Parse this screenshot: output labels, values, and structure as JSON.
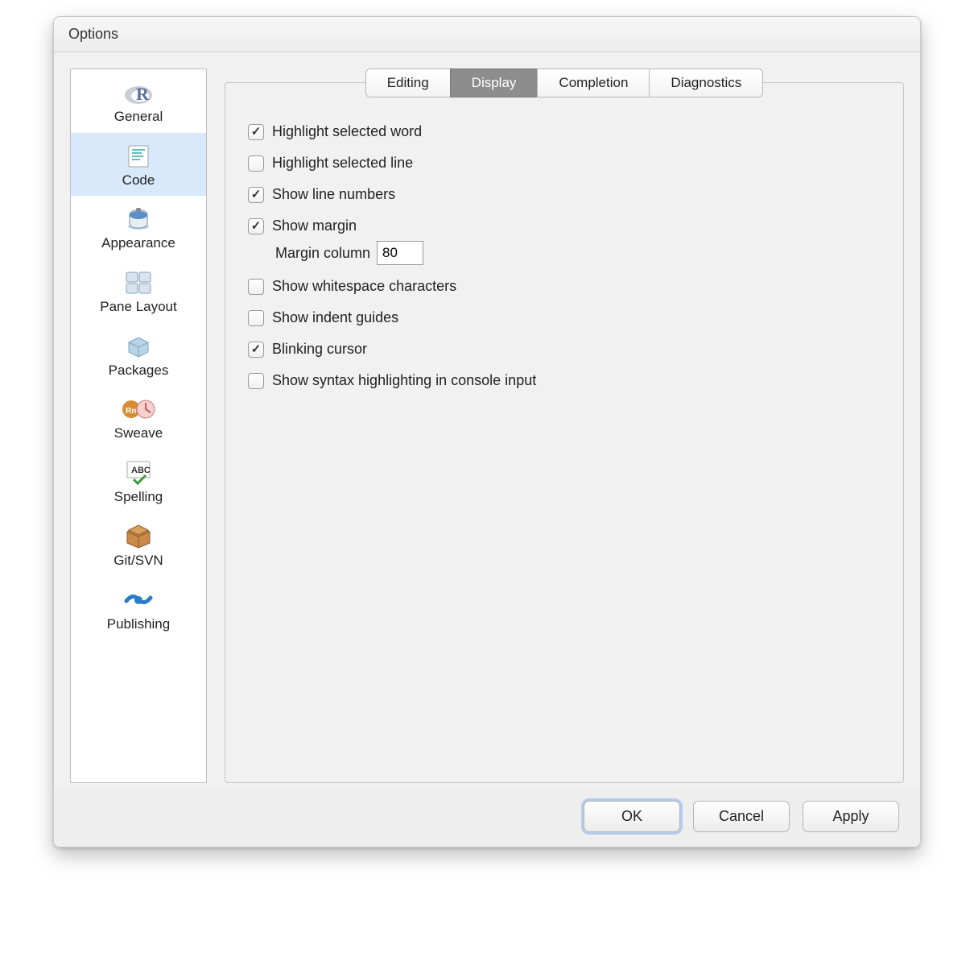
{
  "window_title": "Options",
  "sidebar": {
    "items": [
      {
        "id": "general",
        "label": "General"
      },
      {
        "id": "code",
        "label": "Code",
        "selected": true
      },
      {
        "id": "appearance",
        "label": "Appearance"
      },
      {
        "id": "pane-layout",
        "label": "Pane Layout"
      },
      {
        "id": "packages",
        "label": "Packages"
      },
      {
        "id": "sweave",
        "label": "Sweave"
      },
      {
        "id": "spelling",
        "label": "Spelling"
      },
      {
        "id": "gitsvn",
        "label": "Git/SVN"
      },
      {
        "id": "publishing",
        "label": "Publishing"
      }
    ]
  },
  "tabs": [
    {
      "id": "editing",
      "label": "Editing"
    },
    {
      "id": "display",
      "label": "Display",
      "active": true
    },
    {
      "id": "completion",
      "label": "Completion"
    },
    {
      "id": "diagnostics",
      "label": "Diagnostics"
    }
  ],
  "options": {
    "highlight_word": {
      "label": "Highlight selected word",
      "checked": true
    },
    "highlight_line": {
      "label": "Highlight selected line",
      "checked": false
    },
    "show_line_numbers": {
      "label": "Show line numbers",
      "checked": true
    },
    "show_margin": {
      "label": "Show margin",
      "checked": true
    },
    "margin_column_label": "Margin column",
    "margin_column_value": "80",
    "show_whitespace": {
      "label": "Show whitespace characters",
      "checked": false
    },
    "show_indent_guides": {
      "label": "Show indent guides",
      "checked": false
    },
    "blinking_cursor": {
      "label": "Blinking cursor",
      "checked": true
    },
    "syntax_console": {
      "label": "Show syntax highlighting in console input",
      "checked": false
    }
  },
  "buttons": {
    "ok": "OK",
    "cancel": "Cancel",
    "apply": "Apply"
  }
}
